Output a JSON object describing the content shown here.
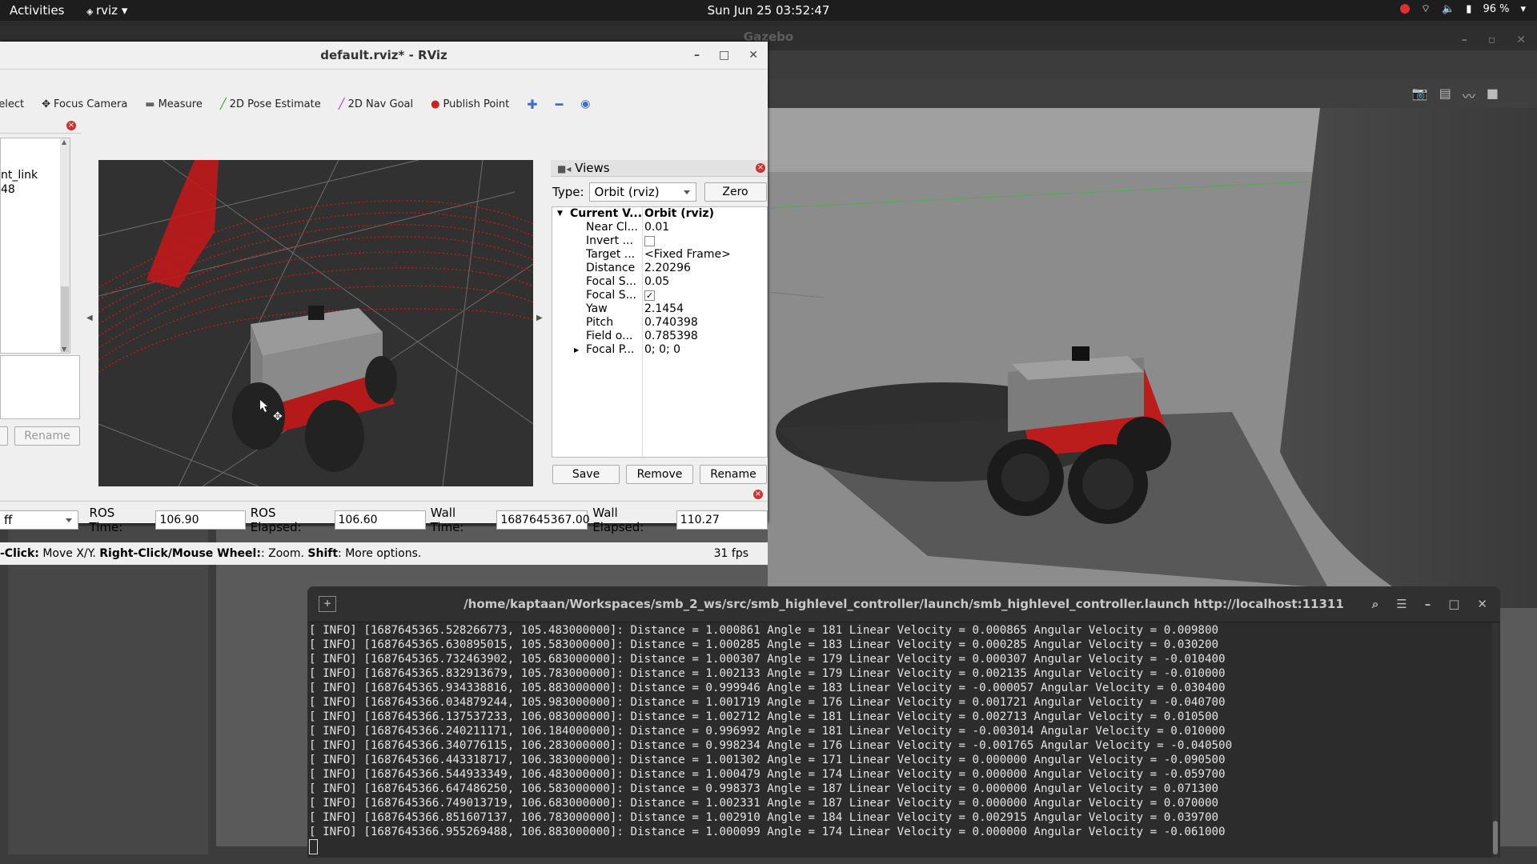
{
  "topbar": {
    "activities": "Activities",
    "app_menu": "rviz",
    "clock": "Sun Jun 25  03:52:47",
    "battery": "96 %"
  },
  "gazebo": {
    "title": "Gazebo"
  },
  "rviz": {
    "title": "default.rviz* - RViz",
    "toolbar": {
      "select": "Select",
      "focus_camera": "Focus Camera",
      "measure": "Measure",
      "pose_estimate": "2D Pose Estimate",
      "nav_goal": "2D Nav Goal",
      "publish_point": "Publish Point"
    },
    "left_panel": {
      "tree_line1": "nt_link",
      "tree_line2": "48",
      "rename": "Rename"
    },
    "views": {
      "title": "Views",
      "type_label": "Type:",
      "type_value": "Orbit (rviz)",
      "zero": "Zero",
      "rows": [
        {
          "key": "Current V...",
          "value": "Orbit (rviz)"
        },
        {
          "key": "Near Cl...",
          "value": "0.01"
        },
        {
          "key": "Invert ...",
          "value": ""
        },
        {
          "key": "Target ...",
          "value": "<Fixed Frame>"
        },
        {
          "key": "Distance",
          "value": "2.20296"
        },
        {
          "key": "Focal S...",
          "value": "0.05"
        },
        {
          "key": "Focal S...",
          "value": ""
        },
        {
          "key": "Yaw",
          "value": "2.1454"
        },
        {
          "key": "Pitch",
          "value": "0.740398"
        },
        {
          "key": "Field o...",
          "value": "0.785398"
        },
        {
          "key": "Focal P...",
          "value": "0; 0; 0"
        }
      ],
      "save": "Save",
      "remove": "Remove",
      "rename": "Rename"
    },
    "time": {
      "combo": "ff",
      "ros_time_label": "ROS Time:",
      "ros_time": "106.90",
      "ros_elapsed_label": "ROS Elapsed:",
      "ros_elapsed": "106.60",
      "wall_time_label": "Wall Time:",
      "wall_time": "1687645367.00",
      "wall_elapsed_label": "Wall Elapsed:",
      "wall_elapsed": "110.27"
    },
    "status": {
      "click_bold": "-Click:",
      "click_text": " Move X/Y. ",
      "right_bold": "Right-Click/Mouse Wheel:",
      "right_text": ": Zoom. ",
      "shift_bold": "Shift",
      "shift_text": ": More options.",
      "fps": "31 fps"
    }
  },
  "terminal": {
    "title": "/home/kaptaan/Workspaces/smb_2_ws/src/smb_highlevel_controller/launch/smb_highlevel_controller.launch http://localhost:11311",
    "lines": [
      "[ INFO] [1687645365.528266773, 105.483000000]: Distance = 1.000861 Angle = 181 Linear Velocity = 0.000865 Angular Velocity = 0.009800",
      "[ INFO] [1687645365.630895015, 105.583000000]: Distance = 1.000285 Angle = 183 Linear Velocity = 0.000285 Angular Velocity = 0.030200",
      "[ INFO] [1687645365.732463902, 105.683000000]: Distance = 1.000307 Angle = 179 Linear Velocity = 0.000307 Angular Velocity = -0.010400",
      "[ INFO] [1687645365.832913679, 105.783000000]: Distance = 1.002133 Angle = 179 Linear Velocity = 0.002135 Angular Velocity = -0.010000",
      "[ INFO] [1687645365.934338816, 105.883000000]: Distance = 0.999946 Angle = 183 Linear Velocity = -0.000057 Angular Velocity = 0.030400",
      "[ INFO] [1687645366.034879244, 105.983000000]: Distance = 1.001719 Angle = 176 Linear Velocity = 0.001721 Angular Velocity = -0.040700",
      "[ INFO] [1687645366.137537233, 106.083000000]: Distance = 1.002712 Angle = 181 Linear Velocity = 0.002713 Angular Velocity = 0.010500",
      "[ INFO] [1687645366.240211171, 106.184000000]: Distance = 0.996992 Angle = 181 Linear Velocity = -0.003014 Angular Velocity = 0.010000",
      "[ INFO] [1687645366.340776115, 106.283000000]: Distance = 0.998234 Angle = 176 Linear Velocity = -0.001765 Angular Velocity = -0.040500",
      "[ INFO] [1687645366.443318717, 106.383000000]: Distance = 1.001302 Angle = 171 Linear Velocity = 0.000000 Angular Velocity = -0.090500",
      "[ INFO] [1687645366.544933349, 106.483000000]: Distance = 1.000479 Angle = 174 Linear Velocity = 0.000000 Angular Velocity = -0.059700",
      "[ INFO] [1687645366.647486250, 106.583000000]: Distance = 0.998373 Angle = 187 Linear Velocity = 0.000000 Angular Velocity = 0.071300",
      "[ INFO] [1687645366.749013719, 106.683000000]: Distance = 1.002331 Angle = 187 Linear Velocity = 0.000000 Angular Velocity = 0.070000",
      "[ INFO] [1687645366.851607137, 106.783000000]: Distance = 1.002910 Angle = 184 Linear Velocity = 0.002915 Angular Velocity = 0.039700",
      "[ INFO] [1687645366.955269488, 106.883000000]: Distance = 1.000099 Angle = 174 Linear Velocity = 0.000000 Angular Velocity = -0.061000"
    ]
  }
}
